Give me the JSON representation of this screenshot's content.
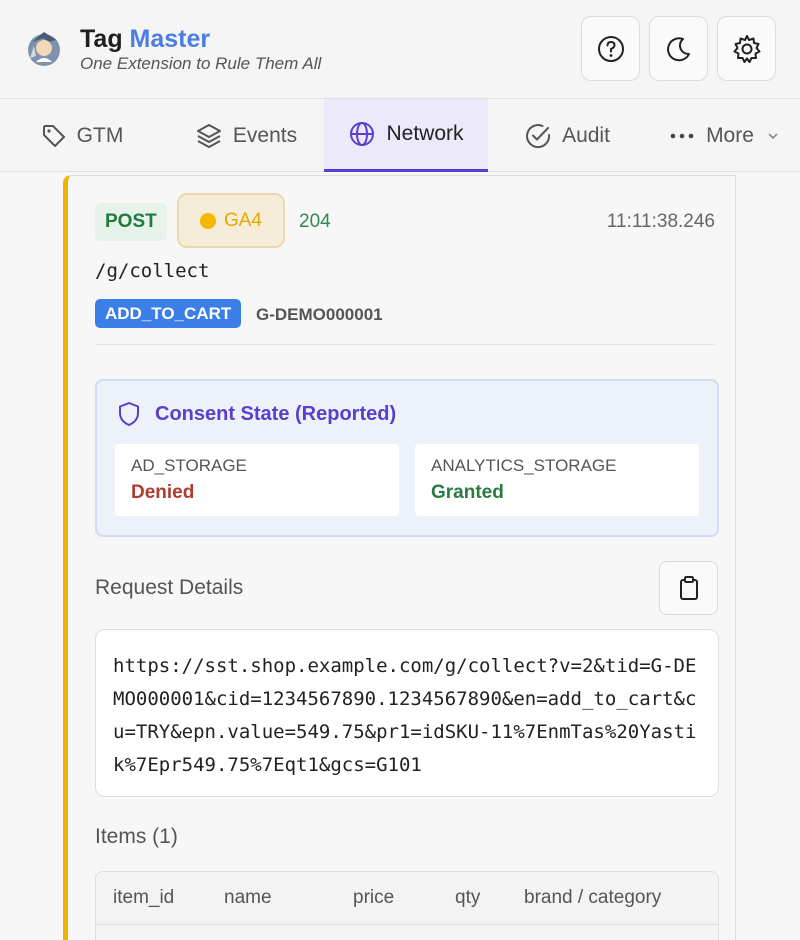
{
  "header": {
    "title_main": "Tag",
    "title_accent": "Master",
    "subtitle": "One Extension to Rule Them All"
  },
  "toolbar": {
    "help_icon": "help-circle-icon",
    "theme_icon": "moon-icon",
    "settings_icon": "gear-icon"
  },
  "tabs": [
    {
      "label": "GTM",
      "icon": "tag-icon"
    },
    {
      "label": "Events",
      "icon": "layers-icon"
    },
    {
      "label": "Network",
      "icon": "globe-icon",
      "active": true
    },
    {
      "label": "Audit",
      "icon": "check-circle-icon"
    },
    {
      "label": "More",
      "icon": "more-icon"
    }
  ],
  "request": {
    "method": "POST",
    "vendor": "GA4",
    "status_code": "204",
    "timestamp": "11:11:38.246",
    "path": "/g/collect",
    "event_name": "ADD_TO_CART",
    "measurement_id": "G-DEMO000001"
  },
  "consent": {
    "title": "Consent State (Reported)",
    "items": [
      {
        "key": "AD_STORAGE",
        "value": "Denied",
        "color": "#b03a2e"
      },
      {
        "key": "ANALYTICS_STORAGE",
        "value": "Granted",
        "color": "#2a7a43"
      }
    ]
  },
  "request_details": {
    "title": "Request Details",
    "url": "https://sst.shop.example.com/g/collect?v=2&tid=G-DEMO000001&cid=1234567890.1234567890&en=add_to_cart&cu=TRY&epn.value=549.75&pr1=idSKU-11%7EnmTas%20Yastik%7Epr549.75%7Eqt1&gcs=G101"
  },
  "items": {
    "title": "Items (1)",
    "columns": [
      "item_id",
      "name",
      "price",
      "qty",
      "brand / category"
    ]
  },
  "colors": {
    "accent": "#5b3fd0",
    "brand_blue": "#4a7fe0",
    "card_border": "#f0b400"
  }
}
